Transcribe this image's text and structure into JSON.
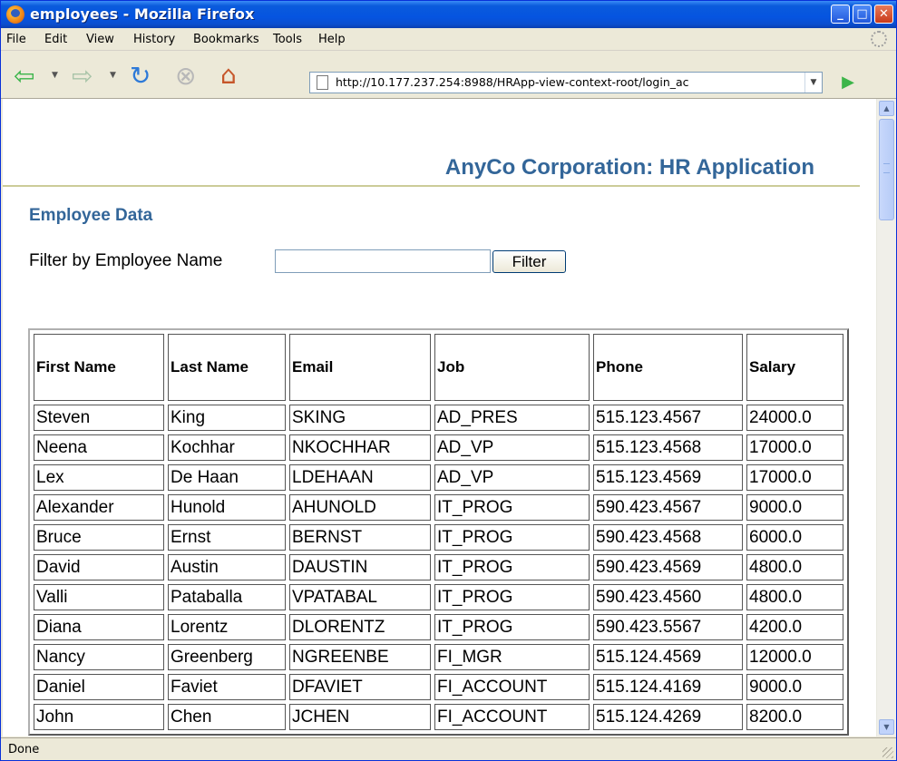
{
  "window": {
    "title": "employees - Mozilla Firefox",
    "minimize": "_",
    "maximize": "□",
    "close": "✕"
  },
  "menu": [
    "File",
    "Edit",
    "View",
    "History",
    "Bookmarks",
    "Tools",
    "Help"
  ],
  "nav": {
    "url": "http://10.177.237.254:8988/HRApp-view-context-root/login_ac",
    "icons": [
      "back-icon",
      "forward-icon",
      "reload-icon",
      "stop-icon",
      "home-icon",
      "go-icon"
    ]
  },
  "page": {
    "app_title": "AnyCo Corporation: HR Application",
    "section_title": "Employee Data",
    "filter_label": "Filter by Employee Name",
    "filter_value": "",
    "filter_button": "Filter"
  },
  "table": {
    "columns": [
      "First Name",
      "Last Name",
      "Email",
      "Job",
      "Phone",
      "Salary"
    ],
    "rows": [
      [
        "Steven",
        "King",
        "SKING",
        "AD_PRES",
        "515.123.4567",
        "24000.0"
      ],
      [
        "Neena",
        "Kochhar",
        "NKOCHHAR",
        "AD_VP",
        "515.123.4568",
        "17000.0"
      ],
      [
        "Lex",
        "De Haan",
        "LDEHAAN",
        "AD_VP",
        "515.123.4569",
        "17000.0"
      ],
      [
        "Alexander",
        "Hunold",
        "AHUNOLD",
        "IT_PROG",
        "590.423.4567",
        "9000.0"
      ],
      [
        "Bruce",
        "Ernst",
        "BERNST",
        "IT_PROG",
        "590.423.4568",
        "6000.0"
      ],
      [
        "David",
        "Austin",
        "DAUSTIN",
        "IT_PROG",
        "590.423.4569",
        "4800.0"
      ],
      [
        "Valli",
        "Pataballa",
        "VPATABAL",
        "IT_PROG",
        "590.423.4560",
        "4800.0"
      ],
      [
        "Diana",
        "Lorentz",
        "DLORENTZ",
        "IT_PROG",
        "590.423.5567",
        "4200.0"
      ],
      [
        "Nancy",
        "Greenberg",
        "NGREENBE",
        "FI_MGR",
        "515.124.4569",
        "12000.0"
      ],
      [
        "Daniel",
        "Faviet",
        "DFAVIET",
        "FI_ACCOUNT",
        "515.124.4169",
        "9000.0"
      ],
      [
        "John",
        "Chen",
        "JCHEN",
        "FI_ACCOUNT",
        "515.124.4269",
        "8200.0"
      ]
    ]
  },
  "status": {
    "text": "Done"
  },
  "colors": {
    "heading": "#336699",
    "rule": "#cccc99",
    "titlebar": "#0554e0"
  }
}
